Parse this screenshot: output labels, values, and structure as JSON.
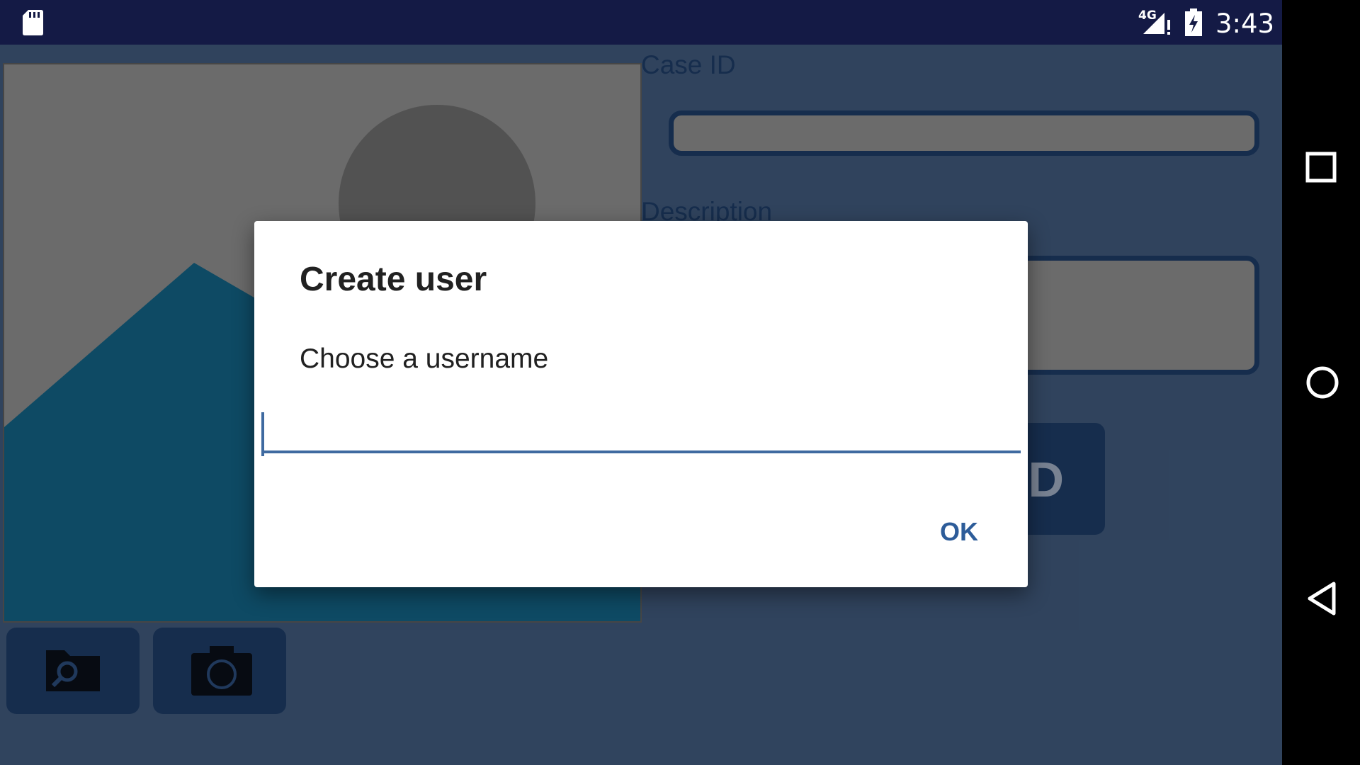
{
  "status_bar": {
    "network_type": "4G",
    "time": "3:43",
    "icons": [
      "sd-card-icon",
      "signal-icon",
      "battery-charging-icon"
    ]
  },
  "app": {
    "case_id_label": "Case ID",
    "case_id_value": "",
    "description_label": "Description",
    "description_value": "",
    "upload_button_label": "UPLOAD",
    "browse_button_icon": "folder-search-icon",
    "camera_button_icon": "camera-icon",
    "image_placeholder_icon": "image-placeholder-icon"
  },
  "dialog": {
    "title": "Create user",
    "message": "Choose a username",
    "input_value": "",
    "ok_label": "OK"
  },
  "nav_bar": {
    "icons": [
      "recents-icon",
      "home-icon",
      "back-icon"
    ]
  },
  "colors": {
    "status_bar": "#141a45",
    "app_background": "#3e5778",
    "accent": "#3f6aa0",
    "button_dark": "#1d3a63"
  }
}
